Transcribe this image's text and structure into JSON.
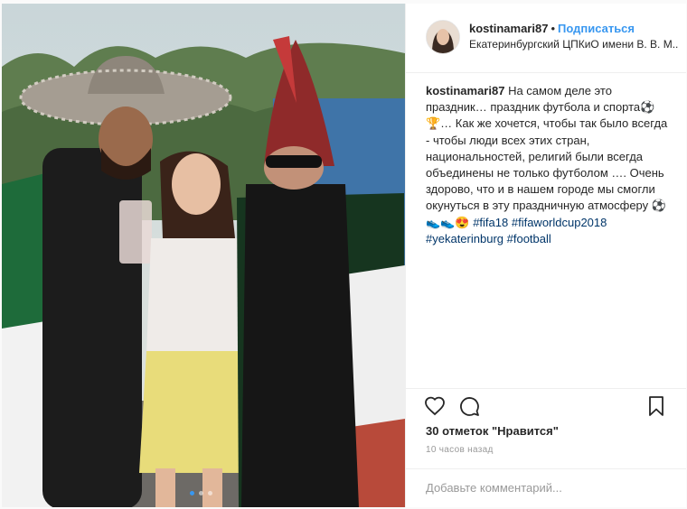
{
  "post": {
    "username": "kostinamari87",
    "separator": "•",
    "follow_label": "Подписаться",
    "location": "Екатеринбургский ЦПКиО имени В. В. М...",
    "caption": {
      "username": "kostinamari87",
      "text": "На самом деле это праздник… праздник футбола и спорта⚽🏆… Как же хочется, чтобы так было всегда - чтобы люди всех этих стран, национальностей, религий были всегда объединены не только футболом …. Очень здорово, что и в нашем городе мы смогли окунуться в эту праздничную атмосферу ⚽👟👟😍",
      "tags": [
        "#fifa18",
        "#fifaworldcup2018",
        "#yekaterinburg",
        "#football"
      ]
    },
    "likes": "30 отметок \"Нравится\"",
    "time_ago": "10 часов назад",
    "comment_placeholder": "Добавьте комментарий...",
    "carousel": {
      "count": 3,
      "active_index": 0
    }
  },
  "icons": {
    "like": "heart-icon",
    "comment": "comment-icon",
    "save": "bookmark-icon"
  },
  "colors": {
    "link_blue": "#3897f0",
    "hashtag": "#003569",
    "text": "#262626",
    "muted": "#999999"
  }
}
